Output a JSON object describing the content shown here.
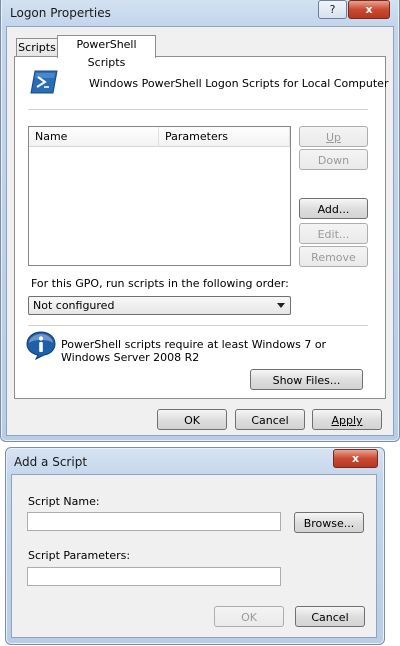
{
  "logon_dialog": {
    "title": "Logon Properties",
    "help_button": "?",
    "close_button": "x",
    "tabs": [
      {
        "label": "Scripts"
      },
      {
        "label": "PowerShell Scripts"
      }
    ],
    "header_text": "Windows PowerShell Logon Scripts for Local Computer",
    "list_columns": [
      "Name",
      "Parameters"
    ],
    "side_buttons": {
      "up": "Up",
      "down": "Down",
      "add": "Add...",
      "edit": "Edit...",
      "remove": "Remove"
    },
    "order_label": "For this GPO, run scripts in the following order:",
    "order_value": "Not configured",
    "info_text": "PowerShell scripts require at least Windows 7 or Windows Server 2008 R2",
    "show_files": "Show Files...",
    "ok": "OK",
    "cancel": "Cancel",
    "apply": "Apply"
  },
  "add_script_dialog": {
    "title": "Add a Script",
    "close_button": "x",
    "script_name_label": "Script Name:",
    "script_name_value": "",
    "browse": "Browse...",
    "script_params_label": "Script Parameters:",
    "script_params_value": "",
    "ok": "OK",
    "cancel": "Cancel"
  },
  "colors": {
    "title_bar": "#c3d6ec",
    "close_red": "#c94a32",
    "dialog_bg": "#f0f0f0",
    "info_icon_blue": "#1f5fa8",
    "powershell_blue": "#2a6cb5"
  },
  "icons": [
    "help-icon",
    "close-icon",
    "powershell-icon",
    "info-icon",
    "dropdown-arrow-icon"
  ]
}
